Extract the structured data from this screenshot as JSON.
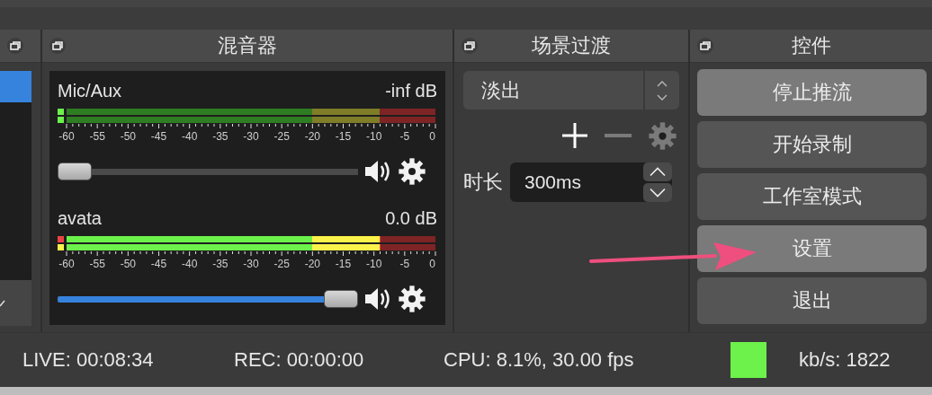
{
  "docks": [
    {
      "kind": "sources"
    },
    {
      "kind": "mixer",
      "title": "混音器"
    },
    {
      "kind": "transitions",
      "title": "场景过渡"
    },
    {
      "kind": "controls",
      "title": "控件"
    }
  ],
  "sources": {
    "items": [
      {
        "selected": true
      }
    ]
  },
  "mixer": {
    "channels": [
      {
        "name": "Mic/Aux",
        "reading": "-inf dB",
        "indicators": [
          {
            "color": "#6cf24a"
          },
          {
            "color": "#6cf24a"
          }
        ],
        "scale": [
          "-60",
          "-55",
          "-50",
          "-45",
          "-40",
          "-35",
          "-30",
          "-25",
          "-20",
          "-15",
          "-10",
          "-5",
          "0"
        ],
        "volume": {
          "level": 0
        }
      },
      {
        "name": "avata",
        "reading": "0.0 dB",
        "meter": {
          "level": 0.85
        },
        "indicators": [
          {
            "color": "#ee4444"
          },
          {
            "color": "#fbf34a"
          }
        ],
        "scale": [
          "-60",
          "-55",
          "-50",
          "-45",
          "-40",
          "-35",
          "-30",
          "-25",
          "-20",
          "-15",
          "-10",
          "-5",
          "0"
        ],
        "volume": {
          "level": 1
        }
      }
    ]
  },
  "transitions": {
    "selected_transition": "淡出",
    "actions": [
      {
        "kind": "add",
        "disabled": false
      },
      {
        "kind": "remove",
        "disabled": true
      },
      {
        "kind": "settings",
        "disabled": true
      }
    ],
    "duration_label": "时长",
    "duration": "300ms"
  },
  "controls": {
    "buttons": [
      {
        "label": "停止推流",
        "highlighted": true
      },
      {
        "label": "开始录制",
        "highlighted": false
      },
      {
        "label": "工作室模式",
        "highlighted": false
      },
      {
        "label": "设置",
        "highlighted": true
      },
      {
        "label": "退出",
        "highlighted": false
      }
    ]
  },
  "status_bar": {
    "live": "LIVE: 00:08:34",
    "rec": "REC: 00:00:00",
    "cpu": "CPU: 8.1%, 30.00 fps",
    "connection": {
      "color": "#6cf24a"
    },
    "bitrate": "kb/s: 1822"
  }
}
